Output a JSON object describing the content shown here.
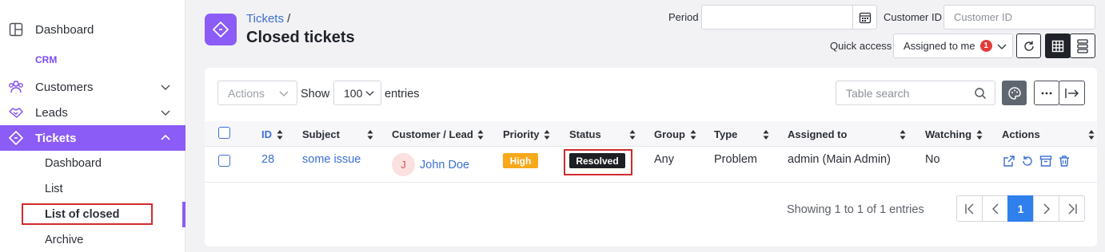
{
  "sidebar": {
    "dashboard": "Dashboard",
    "section": "CRM",
    "customers": "Customers",
    "leads": "Leads",
    "tickets": "Tickets",
    "sub": [
      "Dashboard",
      "List",
      "List of closed",
      "Archive"
    ]
  },
  "header": {
    "crumb": "Tickets",
    "crumb_sep": "/",
    "title": "Closed tickets",
    "period_label": "Period",
    "customer_id_label": "Customer ID",
    "customer_id_placeholder": "Customer ID",
    "quick_access_label": "Quick access",
    "quick_access_value": "Assigned to me",
    "quick_access_count": "1"
  },
  "toolbar": {
    "actions": "Actions",
    "show": "Show",
    "entries_value": "100",
    "entries": "entries",
    "search_placeholder": "Table search"
  },
  "table": {
    "columns": [
      "ID",
      "Subject",
      "Customer / Lead",
      "Priority",
      "Status",
      "Group",
      "Type",
      "Assigned to",
      "Watching",
      "Actions"
    ],
    "rows": [
      {
        "id": "28",
        "subject": "some issue",
        "avatar": "J",
        "customer": "John Doe",
        "priority": "High",
        "status": "Resolved",
        "group": "Any",
        "type": "Problem",
        "assigned": "admin (Main Admin)",
        "watching": "No"
      }
    ]
  },
  "footer": {
    "info": "Showing 1 to 1 of 1 entries",
    "page": "1"
  },
  "colors": {
    "accent": "#8b5cf6",
    "link": "#3b6fd4",
    "high": "#f7a81b",
    "resolved": "#1d1f24",
    "highlight": "#d12b2b"
  }
}
